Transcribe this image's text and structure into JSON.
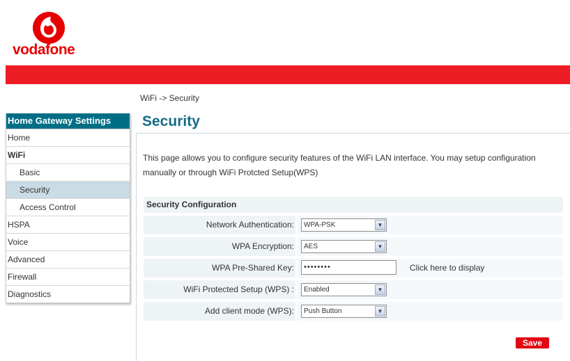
{
  "brand": {
    "name": "vodafone",
    "color": "#e60000"
  },
  "breadcrumb": "WiFi -> Security",
  "sidebar": {
    "title": "Home Gateway Settings",
    "items": [
      {
        "label": "Home"
      },
      {
        "label": "WiFi"
      },
      {
        "label": "Basic"
      },
      {
        "label": "Security"
      },
      {
        "label": "Access Control"
      },
      {
        "label": "HSPA"
      },
      {
        "label": "Voice"
      },
      {
        "label": "Advanced"
      },
      {
        "label": "Firewall"
      },
      {
        "label": "Diagnostics"
      }
    ]
  },
  "main": {
    "title": "Security",
    "intro": "This page allows you to configure security features of the WiFi LAN interface. You may setup configuration manually or through WiFi Protcted Setup(WPS)",
    "section_title": "Security Configuration",
    "fields": [
      {
        "label": "Network Authentication:",
        "value": "WPA-PSK"
      },
      {
        "label": "WPA Encryption:",
        "value": "AES"
      },
      {
        "label": "WPA Pre-Shared Key:",
        "value": "••••••••",
        "link": "Click here to display"
      },
      {
        "label": "WiFi Protected Setup (WPS) :",
        "value": "Enabled"
      },
      {
        "label": "Add client mode (WPS):",
        "value": "Push Button"
      }
    ],
    "save_label": "Save"
  },
  "colors": {
    "red_bar": "#ee1c25",
    "sidebar_title": "#006f86",
    "page_title": "#176c85",
    "active_item": "#c9dbe4"
  },
  "icons": {
    "select_arrow": "chevron-down-icon"
  }
}
